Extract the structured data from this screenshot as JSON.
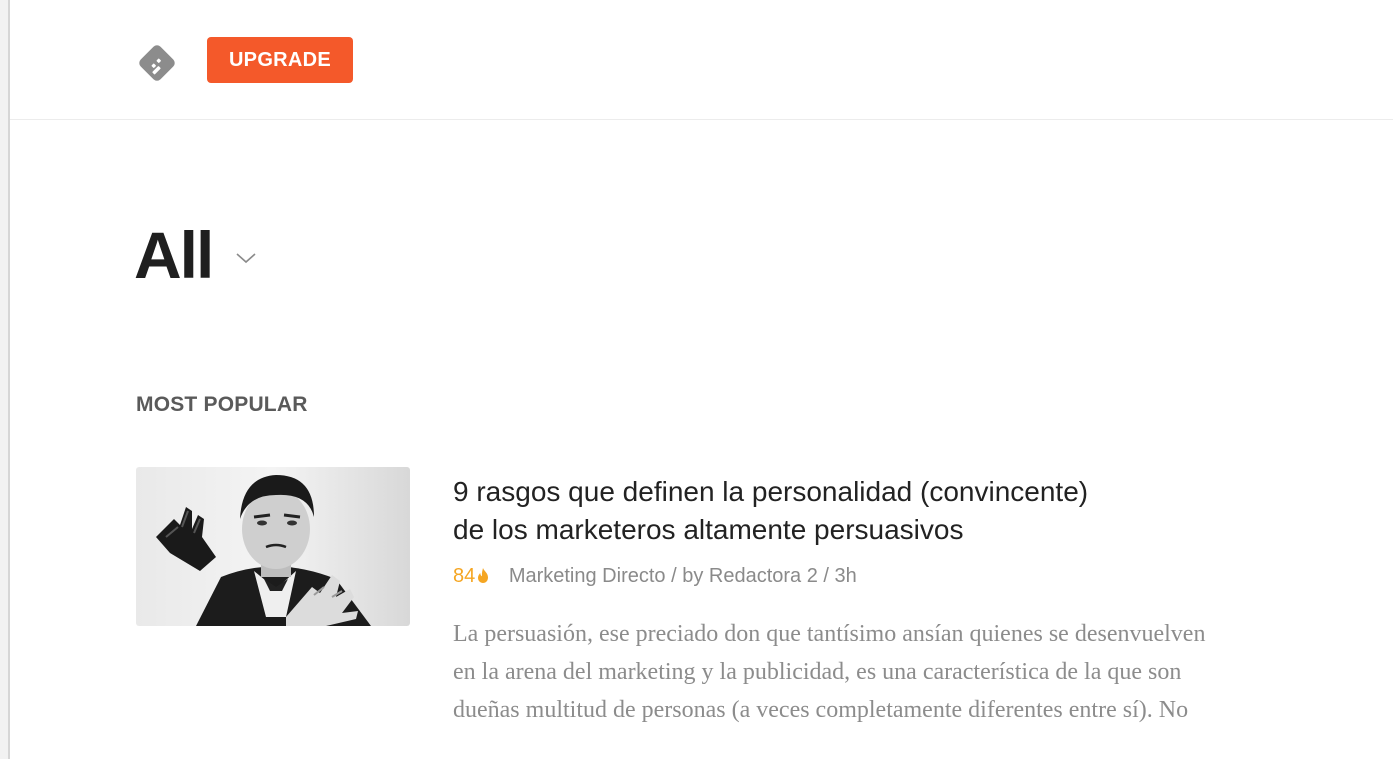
{
  "header": {
    "logo_icon": "feedly-logo-icon",
    "upgrade_label": "UPGRADE",
    "upgrade_color": "#f4592a"
  },
  "page": {
    "title": "All",
    "title_dropdown_icon": "chevron-down-icon"
  },
  "section": {
    "label": "MOST POPULAR"
  },
  "articles": [
    {
      "title_line1": "9 rasgos que definen la personalidad (convincente)",
      "title_line2": "de los marketeros altamente persuasivos",
      "popularity": "84",
      "popularity_icon": "flame-icon",
      "popularity_color": "#f5a623",
      "meta": "Marketing Directo / by Redactora 2 / 3h",
      "summary_line1": "La persuasión, ese preciado don que tantísimo ansían quienes se desenvuelven",
      "summary_line2": "en la arena del marketing y la publicidad, es una característica de la que son",
      "summary_line3": "dueñas multitud de personas (a veces completamente diferentes entre sí). No"
    }
  ]
}
